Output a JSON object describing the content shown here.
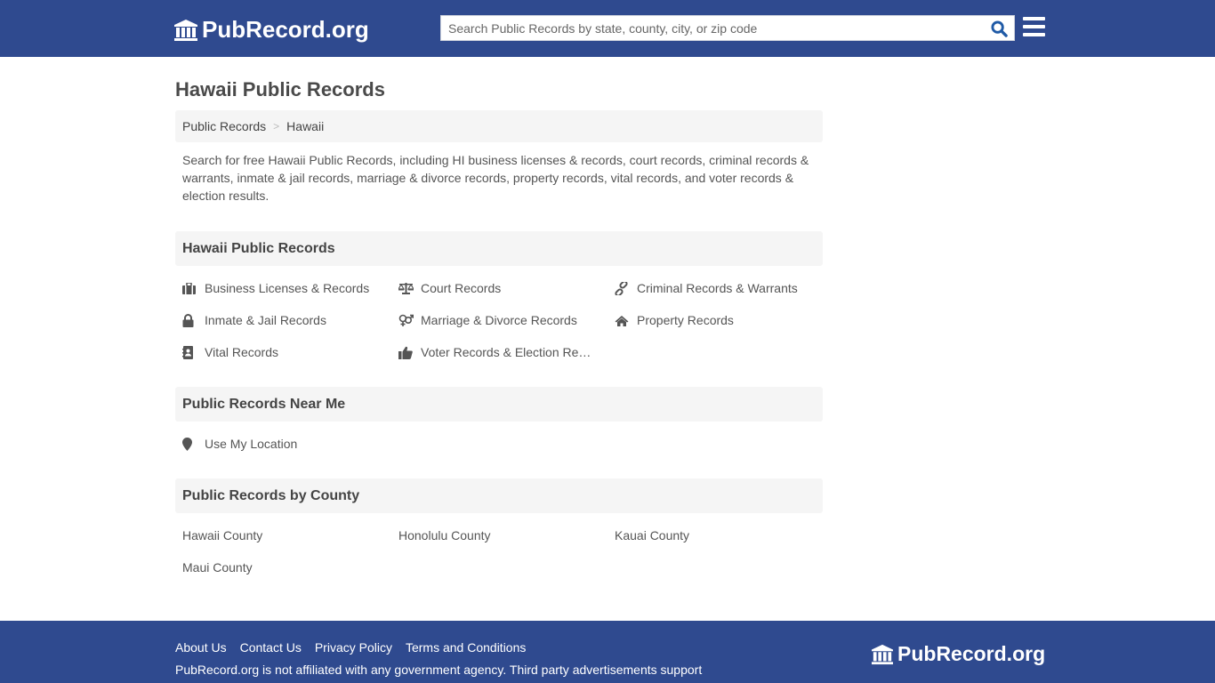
{
  "header": {
    "logo_text": "PubRecord.org",
    "search_placeholder": "Search Public Records by state, county, city, or zip code",
    "search_value": "",
    "search_icon": "search-icon",
    "menu_icon": "hamburger-menu-icon"
  },
  "page": {
    "title": "Hawaii Public Records",
    "breadcrumb": [
      {
        "label": "Public Records"
      },
      {
        "label": "Hawaii"
      }
    ],
    "breadcrumb_separator": ">",
    "intro": "Search for free Hawaii Public Records, including HI business licenses & records, court records, criminal records & warrants, inmate & jail records, marriage & divorce records, property records, vital records, and voter records & election results."
  },
  "records_section": {
    "heading": "Hawaii Public Records",
    "items": [
      {
        "label": "Business Licenses & Records",
        "icon": "briefcase-icon"
      },
      {
        "label": "Court Records",
        "icon": "scale-icon"
      },
      {
        "label": "Criminal Records & Warrants",
        "icon": "link-icon"
      },
      {
        "label": "Inmate & Jail Records",
        "icon": "lock-icon"
      },
      {
        "label": "Marriage & Divorce Records",
        "icon": "gender-icon"
      },
      {
        "label": "Property Records",
        "icon": "home-icon"
      },
      {
        "label": "Vital Records",
        "icon": "address-book-icon"
      },
      {
        "label": "Voter Records & Election Results",
        "icon": "thumbs-up-icon"
      }
    ]
  },
  "near_section": {
    "heading": "Public Records Near Me",
    "item": {
      "label": "Use My Location",
      "icon": "map-marker-icon"
    }
  },
  "county_section": {
    "heading": "Public Records by County",
    "counties": [
      "Hawaii County",
      "Honolulu County",
      "Kauai County",
      "Maui County"
    ]
  },
  "footer": {
    "links": [
      "About Us",
      "Contact Us",
      "Privacy Policy",
      "Terms and Conditions"
    ],
    "note": "PubRecord.org is not affiliated with any government agency. Third party advertisements support",
    "logo_text": "PubRecord.org"
  },
  "colors": {
    "brand": "#2f4a8f",
    "search_icon": "#1f5aa6",
    "section_bg": "#f5f5f5",
    "text": "#444444"
  }
}
